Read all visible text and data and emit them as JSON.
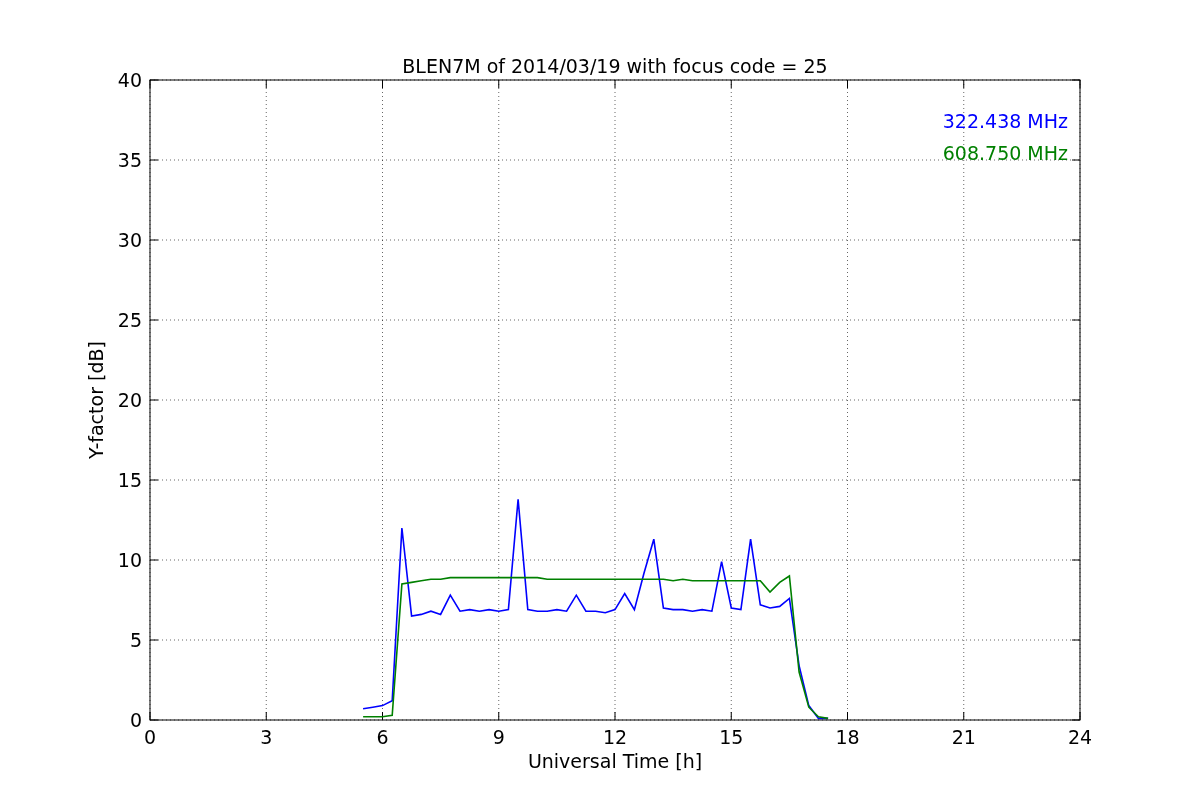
{
  "figure": {
    "chart_data": {
      "type": "line",
      "title": "BLEN7M of 2014/03/19 with focus code = 25",
      "xlabel": "Universal Time [h]",
      "ylabel": "Y-factor [dB]",
      "x": [
        5.5,
        5.75,
        6.0,
        6.25,
        6.5,
        6.75,
        7.0,
        7.25,
        7.5,
        7.75,
        8.0,
        8.25,
        8.5,
        8.75,
        9.0,
        9.25,
        9.5,
        9.75,
        10.0,
        10.25,
        10.5,
        10.75,
        11.0,
        11.25,
        11.5,
        11.75,
        12.0,
        12.25,
        12.5,
        12.75,
        13.0,
        13.25,
        13.5,
        13.75,
        14.0,
        14.25,
        14.5,
        14.75,
        15.0,
        15.25,
        15.5,
        15.75,
        16.0,
        16.25,
        16.5,
        16.75,
        17.0,
        17.25,
        17.5
      ],
      "series": [
        {
          "name": "322.438 MHz",
          "color": "#0000ff",
          "values": [
            0.7,
            0.8,
            0.9,
            1.2,
            12.0,
            6.5,
            6.6,
            6.8,
            6.6,
            7.8,
            6.8,
            6.9,
            6.8,
            6.9,
            6.8,
            6.9,
            13.8,
            6.9,
            6.8,
            6.8,
            6.9,
            6.8,
            7.8,
            6.8,
            6.8,
            6.7,
            6.9,
            7.9,
            6.9,
            9.2,
            11.3,
            7.0,
            6.9,
            6.9,
            6.8,
            6.9,
            6.8,
            9.9,
            7.0,
            6.9,
            11.3,
            7.2,
            7.0,
            7.1,
            7.6,
            3.4,
            0.9,
            0.1,
            0.1
          ]
        },
        {
          "name": "608.750 MHz",
          "color": "#008000",
          "values": [
            0.2,
            0.2,
            0.2,
            0.3,
            8.5,
            8.6,
            8.7,
            8.8,
            8.8,
            8.9,
            8.9,
            8.9,
            8.9,
            8.9,
            8.9,
            8.9,
            8.9,
            8.9,
            8.9,
            8.8,
            8.8,
            8.8,
            8.8,
            8.8,
            8.8,
            8.8,
            8.8,
            8.8,
            8.8,
            8.8,
            8.8,
            8.8,
            8.7,
            8.8,
            8.7,
            8.7,
            8.7,
            8.7,
            8.7,
            8.7,
            8.7,
            8.7,
            8.0,
            8.6,
            9.0,
            3.0,
            0.8,
            0.2,
            0.1
          ]
        }
      ],
      "grid": true,
      "xlim": [
        0,
        24
      ],
      "ylim": [
        0,
        40
      ],
      "xticks": [
        0,
        3,
        6,
        9,
        12,
        15,
        18,
        21,
        24
      ],
      "yticks": [
        0,
        5,
        10,
        15,
        20,
        25,
        30,
        35,
        40
      ]
    }
  }
}
